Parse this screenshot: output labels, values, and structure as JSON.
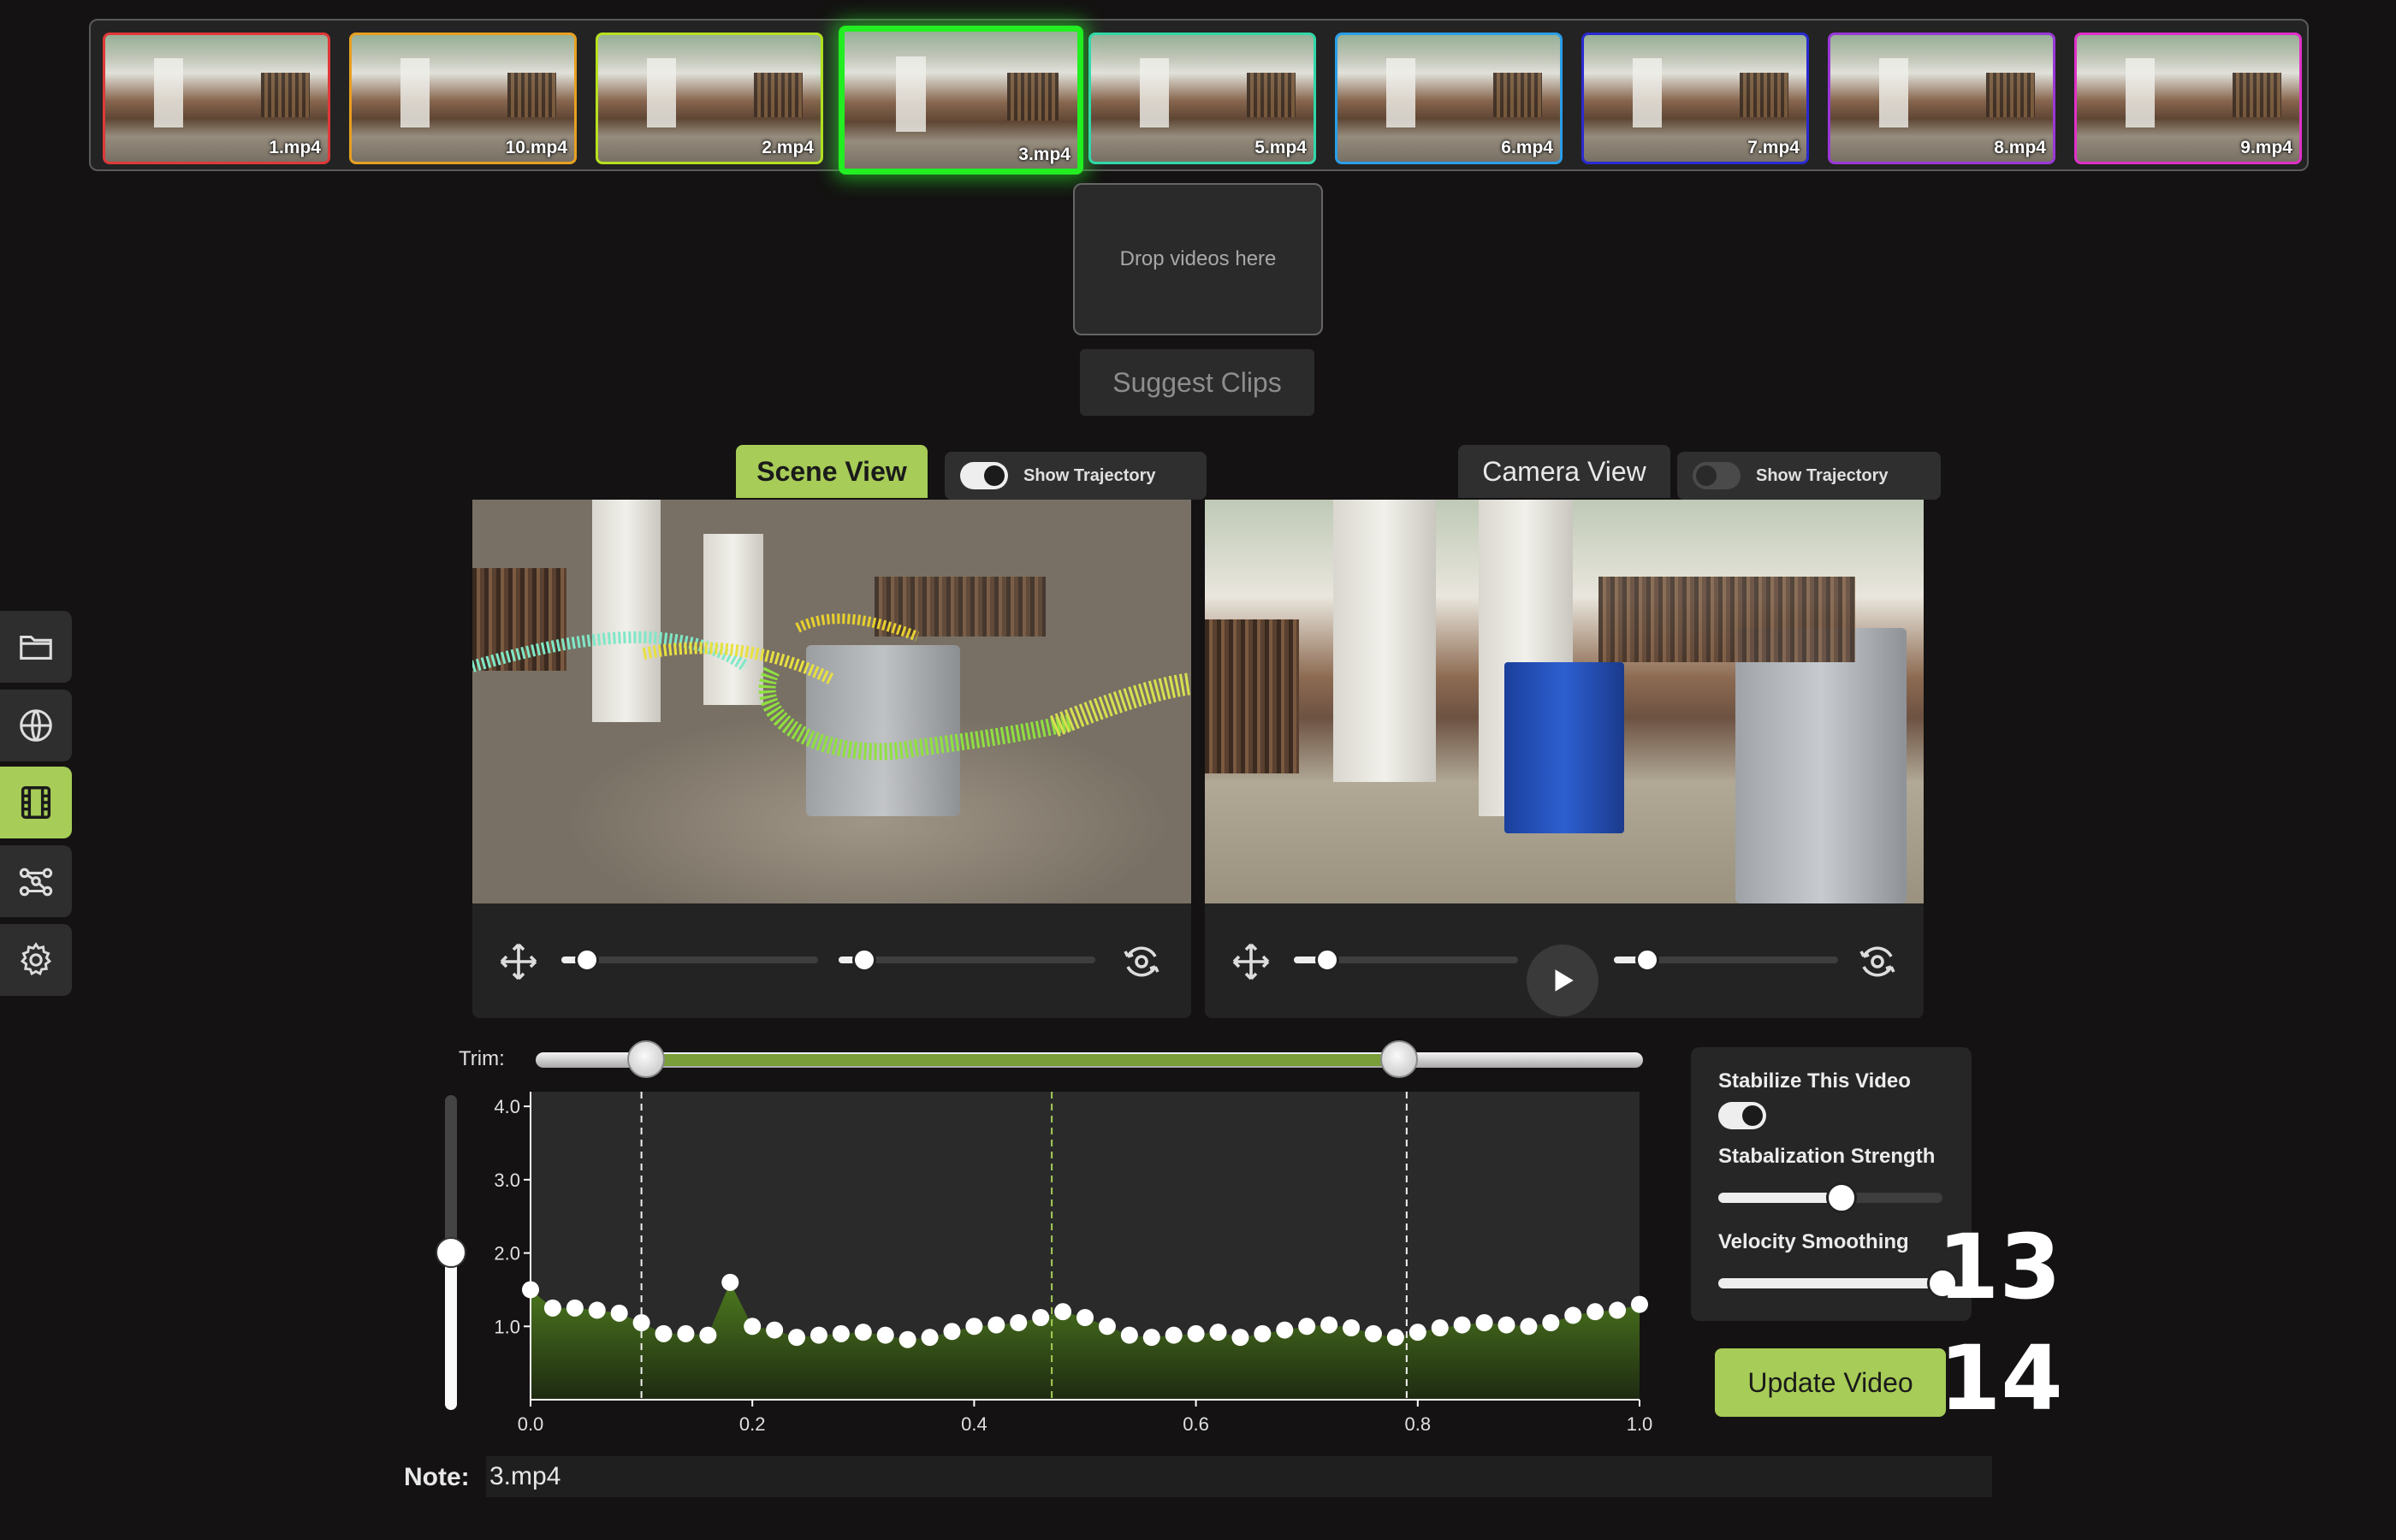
{
  "thumbnails": [
    {
      "label": "1.mp4",
      "border": "#e03838"
    },
    {
      "label": "10.mp4",
      "border": "#e8a020"
    },
    {
      "label": "2.mp4",
      "border": "#b8e020"
    },
    {
      "label": "3.mp4",
      "border": "#22ee22",
      "selected": true
    },
    {
      "label": "5.mp4",
      "border": "#30d8a8"
    },
    {
      "label": "6.mp4",
      "border": "#2a9ee8"
    },
    {
      "label": "7.mp4",
      "border": "#2a2ad0"
    },
    {
      "label": "8.mp4",
      "border": "#9a38d8"
    },
    {
      "label": "9.mp4",
      "border": "#e030c8"
    }
  ],
  "dropzone": {
    "text": "Drop videos here"
  },
  "suggest": {
    "label": "Suggest Clips"
  },
  "sidebar": {
    "items": [
      {
        "icon": "folder-icon"
      },
      {
        "icon": "globe-icon"
      },
      {
        "icon": "film-icon",
        "active": true
      },
      {
        "icon": "graph-icon"
      },
      {
        "icon": "gear-icon"
      }
    ]
  },
  "scene_view": {
    "tab_label": "Scene View",
    "trajectory_label": "Show Trajectory",
    "trajectory_on": true
  },
  "camera_view": {
    "tab_label": "Camera View",
    "trajectory_label": "Show Trajectory",
    "trajectory_on": false,
    "progress": 0.47
  },
  "trim": {
    "label": "Trim:",
    "start": 0.1,
    "end": 0.78
  },
  "chart_data": {
    "type": "area",
    "x": [
      0.0,
      0.02,
      0.04,
      0.06,
      0.08,
      0.1,
      0.12,
      0.14,
      0.16,
      0.18,
      0.2,
      0.22,
      0.24,
      0.26,
      0.28,
      0.3,
      0.32,
      0.34,
      0.36,
      0.38,
      0.4,
      0.42,
      0.44,
      0.46,
      0.48,
      0.5,
      0.52,
      0.54,
      0.56,
      0.58,
      0.6,
      0.62,
      0.64,
      0.66,
      0.68,
      0.7,
      0.72,
      0.74,
      0.76,
      0.78,
      0.8,
      0.82,
      0.84,
      0.86,
      0.88,
      0.9,
      0.92,
      0.94,
      0.96,
      0.98,
      1.0
    ],
    "y": [
      1.5,
      1.25,
      1.25,
      1.22,
      1.18,
      1.05,
      0.9,
      0.9,
      0.88,
      1.6,
      1.0,
      0.95,
      0.85,
      0.88,
      0.9,
      0.92,
      0.88,
      0.82,
      0.85,
      0.93,
      1.0,
      1.02,
      1.05,
      1.12,
      1.2,
      1.12,
      1.0,
      0.88,
      0.85,
      0.88,
      0.9,
      0.92,
      0.85,
      0.9,
      0.95,
      1.0,
      1.02,
      0.98,
      0.9,
      0.85,
      0.92,
      0.98,
      1.02,
      1.05,
      1.02,
      1.0,
      1.05,
      1.15,
      1.2,
      1.22,
      1.3
    ],
    "xticks": [
      "0.0",
      "0.2",
      "0.4",
      "0.6",
      "0.8",
      "1.0"
    ],
    "yticks": [
      "1.0",
      "2.0",
      "3.0",
      "4.0"
    ],
    "xlim": [
      0,
      1
    ],
    "ylim": [
      0,
      4.2
    ],
    "markers": [
      0.1,
      0.47,
      0.79
    ],
    "vertical_slider": 0.5
  },
  "stabilize": {
    "title": "Stabilize This Video",
    "enabled": true,
    "strength_label": "Stabalization Strength",
    "strength": 0.55,
    "velocity_label": "Velocity Smoothing",
    "velocity": 1.0
  },
  "annotations": {
    "a13": "13",
    "a14": "14"
  },
  "update_button": {
    "label": "Update Video"
  },
  "note": {
    "label": "Note:",
    "value": "3.mp4"
  },
  "scene_sliders": [
    0.1,
    0.1
  ],
  "camera_sliders": [
    0.15,
    0.15
  ]
}
